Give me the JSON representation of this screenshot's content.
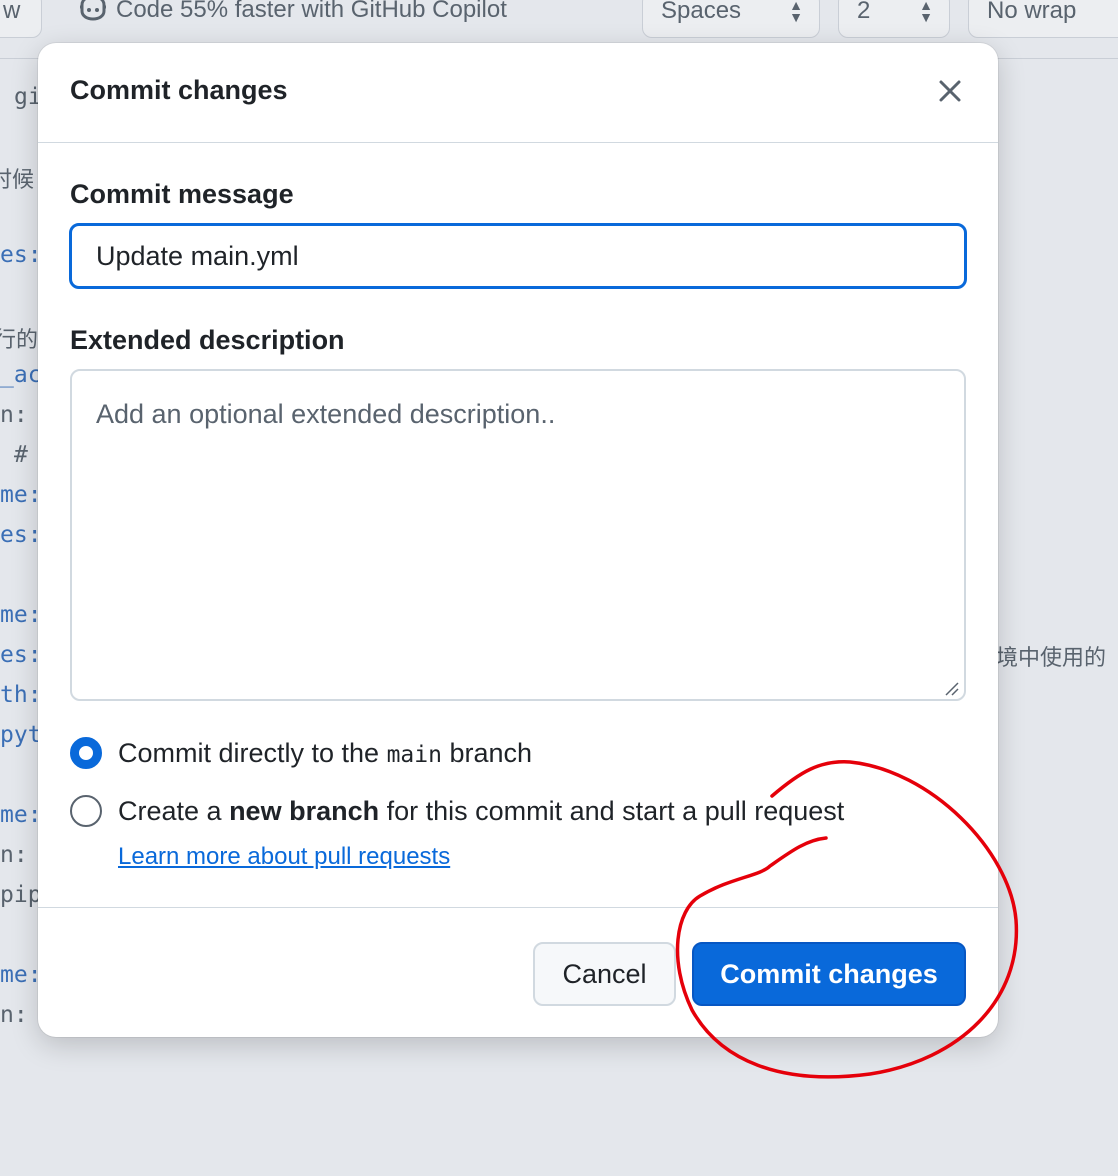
{
  "toolbar": {
    "left_fragment": "w",
    "copilot_promo": "Code 55% faster with GitHub Copilot",
    "indent_mode": "Spaces",
    "indent_size": "2",
    "wrap_mode": "No wrap"
  },
  "background_code": {
    "lines": [
      "gi",
      "时候",
      "es:",
      "行的",
      "_ac",
      "n:",
      "#",
      "me:",
      "es:",
      "me:",
      "es:",
      "th:",
      "pyt",
      "me:",
      "n:",
      "pip",
      "me:",
      "n:"
    ],
    "right_text": "境中使用的"
  },
  "dialog": {
    "title": "Commit changes",
    "commit_message_label": "Commit message",
    "commit_message_value": "Update main.yml",
    "extended_label": "Extended description",
    "extended_placeholder": "Add an optional extended description..",
    "option_direct": {
      "prefix": "Commit directly to the ",
      "branch": "main",
      "suffix": " branch"
    },
    "option_new": {
      "prefix": "Create a ",
      "bold": "new branch",
      "suffix": " for this commit and start a pull request"
    },
    "learn_link": "Learn more about pull requests",
    "cancel_label": "Cancel",
    "commit_label": "Commit changes",
    "selected_option": "direct"
  },
  "colors": {
    "accent": "#0969da",
    "annotation": "#e5000a"
  }
}
